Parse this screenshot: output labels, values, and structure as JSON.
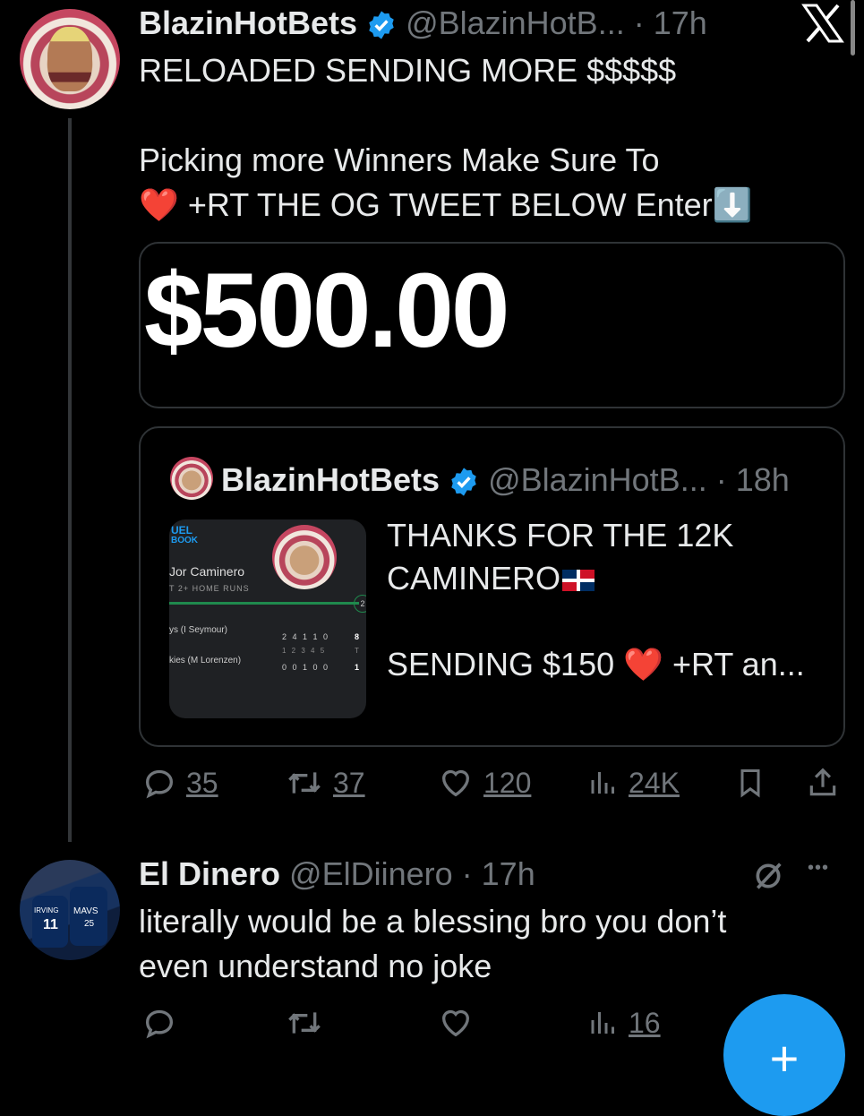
{
  "main_tweet": {
    "display_name": "BlazinHotBets",
    "handle": "@BlazinHotB...",
    "time": "17h",
    "text_line1": "RELOADED SENDING MORE $$$$$",
    "text_line2": "Picking more Winners Make Sure To",
    "text_line3": "+RT THE OG TWEET BELOW Enter",
    "heart_emoji": "❤️",
    "arrow_emoji": "⬇️",
    "image_amount": "$500.00"
  },
  "quoted_tweet": {
    "display_name": "BlazinHotBets",
    "handle": "@BlazinHotB...",
    "time": "18h",
    "text_line1": "THANKS FOR THE 12K",
    "text_line2": "CAMINERO",
    "text_line3": "SENDING $150",
    "text_line3_tail": "+RT an...",
    "media": {
      "brand_line1": "UEL",
      "brand_line2": "BOOK",
      "player": "Jor Caminero",
      "bet": "T 2+ HOME RUNS",
      "row1_team": "ys (I Seymour)",
      "row1_scores": "2 4 1 1 0",
      "row1_total": "8",
      "innings": "1 2 3 4 5",
      "innings_total": "T",
      "row2_team": "kies (M Lorenzen)",
      "row2_scores": "0 0 1 0 0",
      "row2_total": "1",
      "badge": "2"
    }
  },
  "main_actions": {
    "replies": "35",
    "reposts": "37",
    "likes": "120",
    "views": "24K"
  },
  "reply_tweet": {
    "display_name": "El Dinero",
    "handle": "@ElDiinero",
    "time": "17h",
    "text_line1": "literally would be a blessing bro you don’t",
    "text_line2": "even understand no joke",
    "more": "•••",
    "views": "16",
    "avatar_jersey1": "11",
    "avatar_jersey2": "25",
    "avatar_team1": "IRVING",
    "avatar_team2": "MAVS"
  },
  "colors": {
    "background": "#000000",
    "text": "#e7e9ea",
    "muted": "#71767b",
    "verified": "#1d9bf0",
    "accent": "#1d9bf0",
    "border": "#2f3336"
  }
}
